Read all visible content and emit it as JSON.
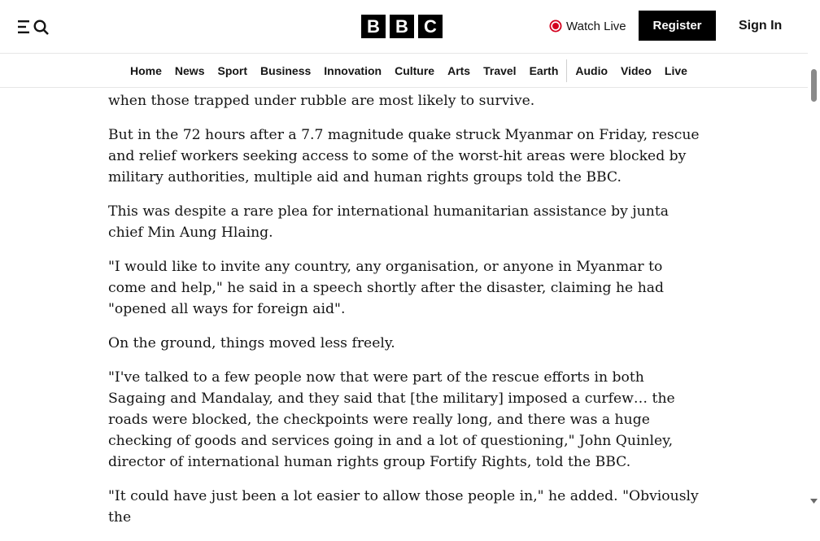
{
  "header": {
    "logo_letters": [
      "B",
      "B",
      "C"
    ],
    "watch_live": "Watch Live",
    "register": "Register",
    "sign_in": "Sign In",
    "icons": {
      "menu": "menu-search-icon",
      "live": "live-record-icon"
    },
    "live_color": "#d4001e"
  },
  "nav": {
    "items": [
      {
        "label": "Home"
      },
      {
        "label": "News"
      },
      {
        "label": "Sport"
      },
      {
        "label": "Business"
      },
      {
        "label": "Innovation"
      },
      {
        "label": "Culture"
      },
      {
        "label": "Arts"
      },
      {
        "label": "Travel"
      },
      {
        "label": "Earth"
      },
      {
        "label": "Audio"
      },
      {
        "label": "Video"
      },
      {
        "label": "Live"
      }
    ]
  },
  "article": {
    "paragraphs": [
      "when those trapped under rubble are most likely to survive.",
      "But in the 72 hours after a 7.7 magnitude quake struck Myanmar on Friday, rescue and relief workers seeking access to some of the worst-hit areas were blocked by military authorities, multiple aid and human rights groups told the BBC.",
      "This was despite a rare plea for international humanitarian assistance by junta chief Min Aung Hlaing.",
      "\"I would like to invite any country, any organisation, or anyone in Myanmar to come and help,\" he said in a speech shortly after the disaster, claiming he had \"opened all ways for foreign aid\".",
      "On the ground, things moved less freely.",
      "\"I've talked to a few people now that were part of the rescue efforts in both Sagaing and Mandalay, and they said that [the military] imposed a curfew… the roads were blocked, the checkpoints were really long, and there was a huge checking of goods and services going in and a lot of questioning,\" John Quinley, director of international human rights group Fortify Rights, told the BBC.",
      "\"It could have just been a lot easier to allow those people in,\" he added. \"Obviously the"
    ]
  }
}
